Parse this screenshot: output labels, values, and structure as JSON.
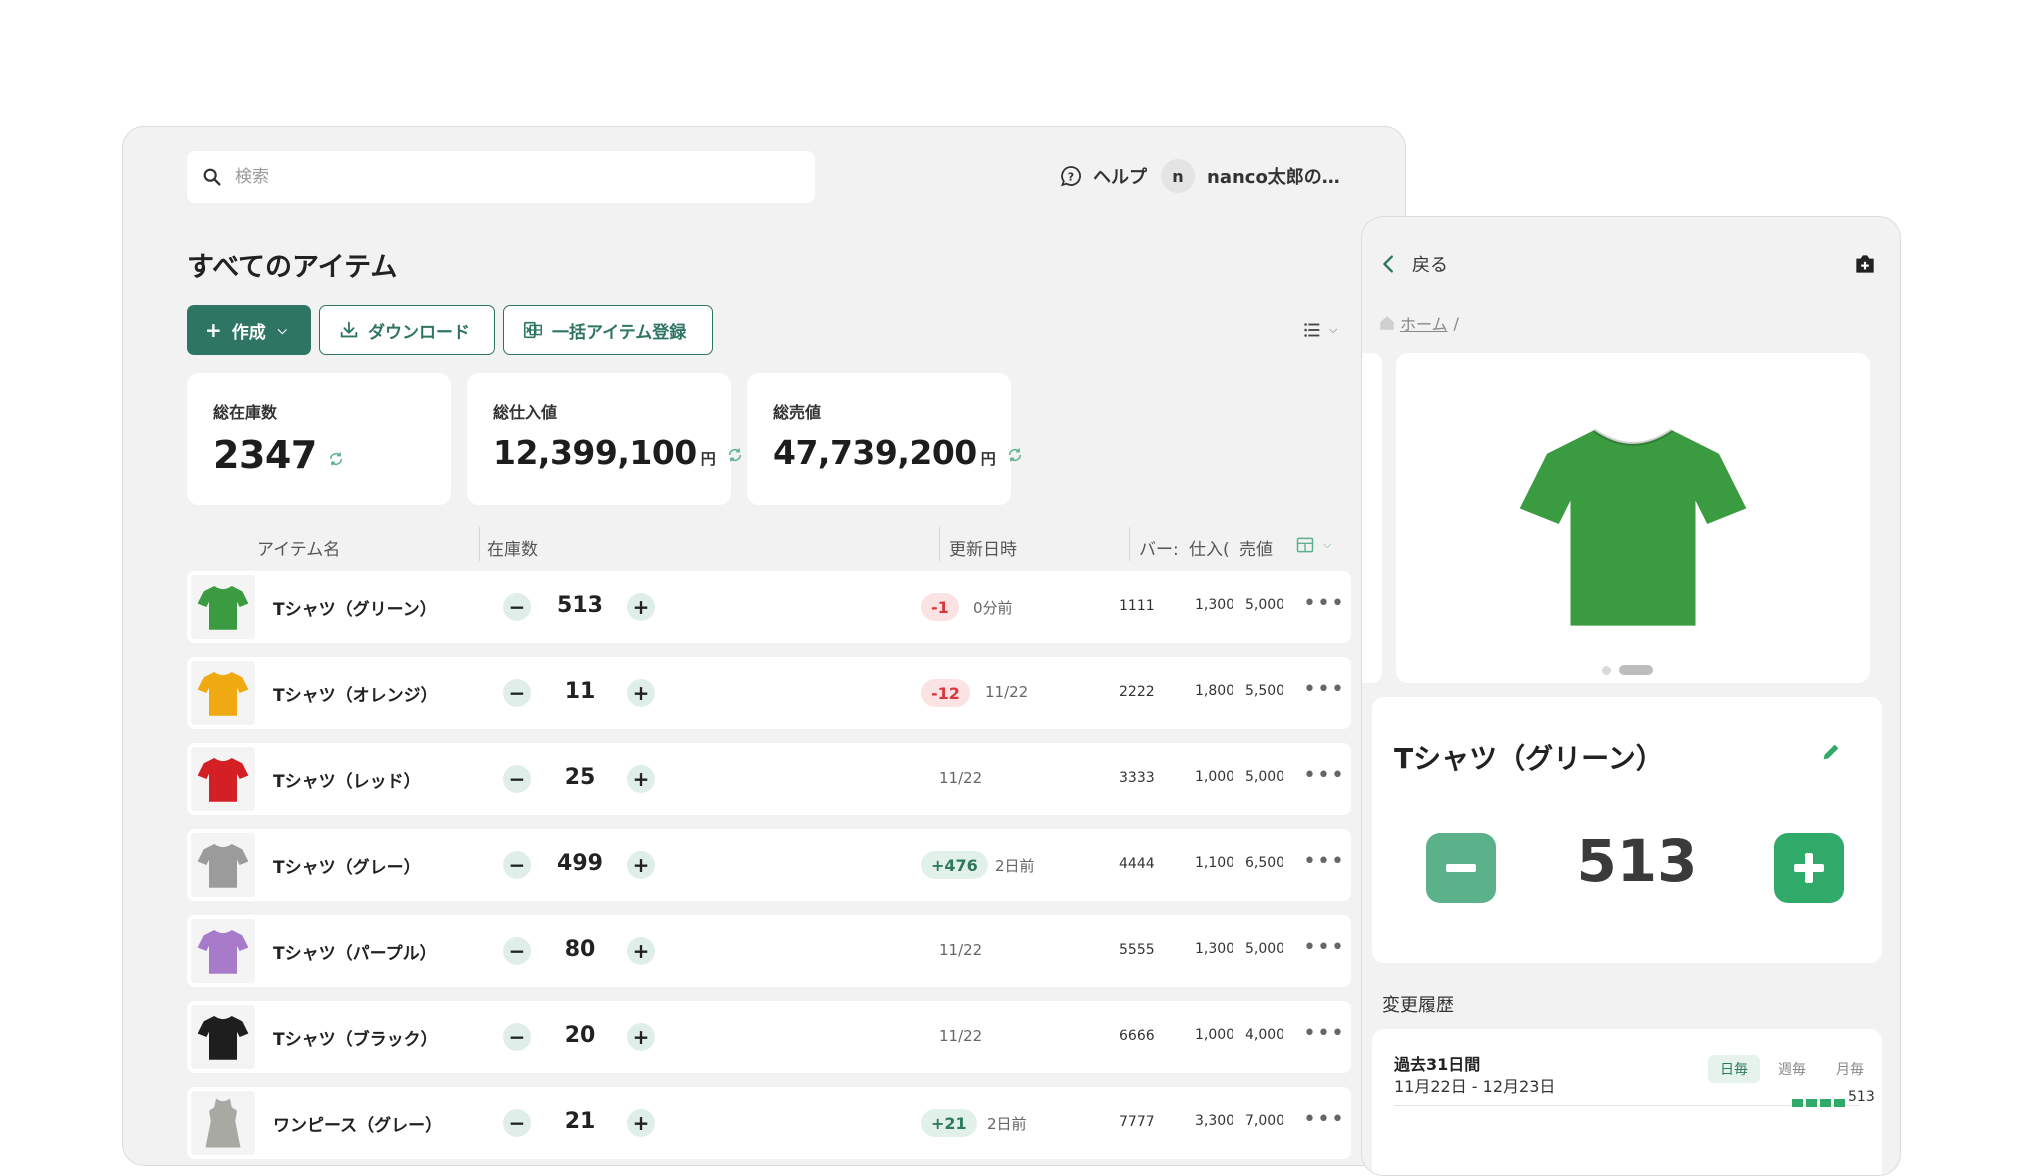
{
  "header": {
    "search_placeholder": "検索",
    "help_label": "ヘルプ",
    "user_initial": "n",
    "user_name": "nanco太郎の…"
  },
  "page": {
    "title": "すべてのアイテム"
  },
  "toolbar": {
    "create_label": "作成",
    "download_label": "ダウンロード",
    "bulk_label": "一括アイテム登録"
  },
  "stats": [
    {
      "label": "総在庫数",
      "value": "2347",
      "unit": ""
    },
    {
      "label": "総仕入値",
      "value": "12,399,100",
      "unit": "円"
    },
    {
      "label": "総売値",
      "value": "47,739,200",
      "unit": "円"
    }
  ],
  "table": {
    "columns": [
      "アイテム名",
      "在庫数",
      "更新日時",
      "バー:",
      "仕入(",
      "売値"
    ],
    "rows": [
      {
        "name": "Tシャツ（グリーン）",
        "qty": "513",
        "delta": "-1",
        "updated": "0分前",
        "barcode": "1111",
        "cost": "1,300",
        "price": "5,000",
        "color": "#3a9b41"
      },
      {
        "name": "Tシャツ（オレンジ）",
        "qty": "11",
        "delta": "-12",
        "updated": "11/22",
        "barcode": "2222",
        "cost": "1,800",
        "price": "5,500",
        "color": "#f0a911"
      },
      {
        "name": "Tシャツ（レッド）",
        "qty": "25",
        "delta": "",
        "updated": "11/22",
        "barcode": "3333",
        "cost": "1,000",
        "price": "5,000",
        "color": "#d41f24"
      },
      {
        "name": "Tシャツ（グレー）",
        "qty": "499",
        "delta": "+476",
        "updated": "2日前",
        "barcode": "4444",
        "cost": "1,100",
        "price": "6,500",
        "color": "#9b9b9b"
      },
      {
        "name": "Tシャツ（パープル）",
        "qty": "80",
        "delta": "",
        "updated": "11/22",
        "barcode": "5555",
        "cost": "1,300",
        "price": "5,000",
        "color": "#a77bc9"
      },
      {
        "name": "Tシャツ（ブラック）",
        "qty": "20",
        "delta": "",
        "updated": "11/22",
        "barcode": "6666",
        "cost": "1,000",
        "price": "4,000",
        "color": "#1e1e1e"
      },
      {
        "name": "ワンピース（グレー）",
        "qty": "21",
        "delta": "+21",
        "updated": "2日前",
        "barcode": "7777",
        "cost": "3,300",
        "price": "7,000",
        "color": "#a9a9a4"
      }
    ]
  },
  "detail": {
    "back_label": "戻る",
    "breadcrumb_home": "ホーム",
    "breadcrumb_sep": "/",
    "item_name": "Tシャツ（グリーン）",
    "qty": "513",
    "history_label": "変更履歴",
    "period_title": "過去31日間",
    "period_range": "11月22日 - 12月23日",
    "segments": [
      "日毎",
      "週毎",
      "月毎"
    ],
    "chart_label": "513"
  },
  "colors": {
    "brand": "#2f7563",
    "minus_big": "#5bb18a",
    "plus_big": "#2faa69",
    "negative": "#d9363e",
    "positive": "#2f7a5e"
  }
}
